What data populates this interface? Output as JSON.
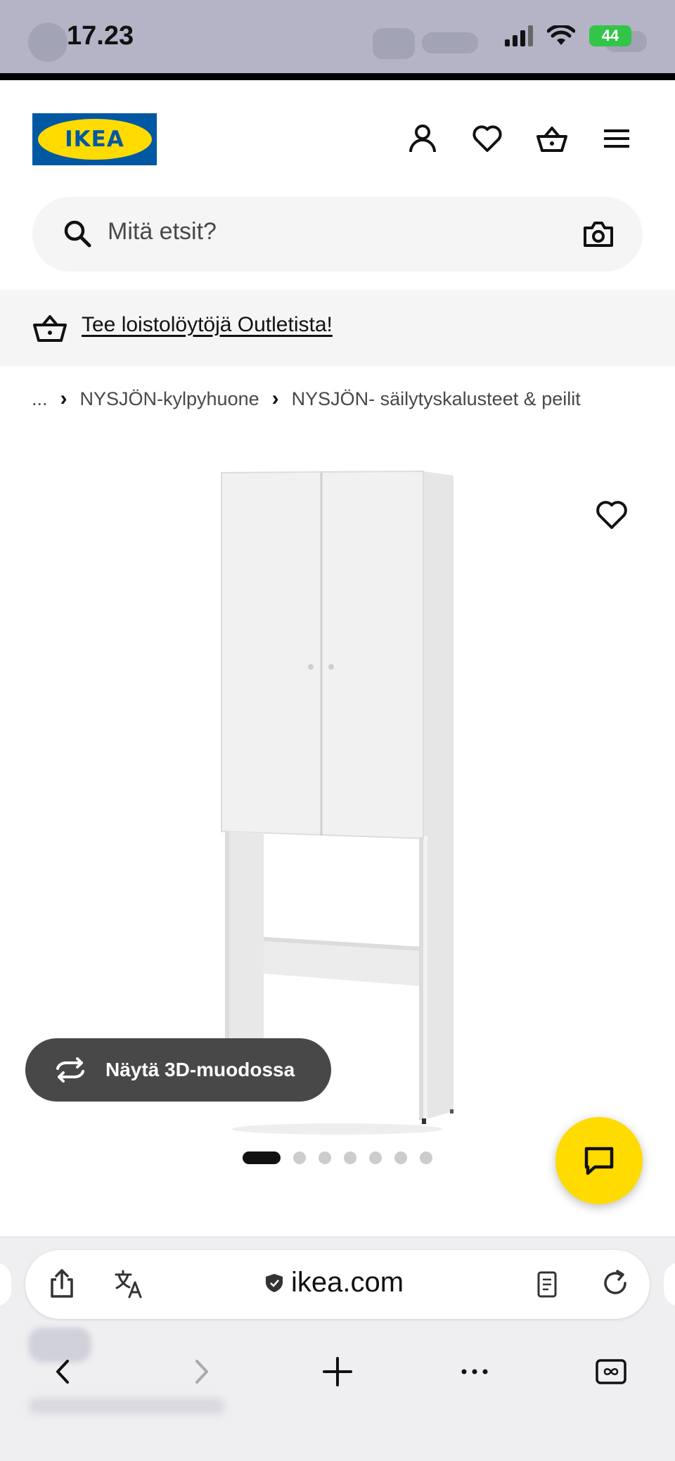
{
  "status_bar": {
    "time": "17.23",
    "battery": "44"
  },
  "header": {
    "logo_text": "IKEA",
    "colors": {
      "logo_blue": "#0058a3",
      "logo_yellow": "#ffdb00"
    },
    "icons": [
      "account-icon",
      "heart-icon",
      "basket-icon",
      "menu-icon"
    ]
  },
  "search": {
    "placeholder": "Mitä etsit?"
  },
  "banner": {
    "text": "Tee loistolöytöjä Outletista!"
  },
  "breadcrumb": {
    "items": [
      "...",
      "NYSJÖN-kylpyhuone",
      "NYSJÖN- säilytyskalusteet & peilit"
    ]
  },
  "product": {
    "view_3d_label": "Näytä 3D-muodossa",
    "image_count": 7,
    "active_image": 1
  },
  "chat": {
    "color": "#ffdb00"
  },
  "browser": {
    "url": "ikea.com",
    "toolbar_icons": [
      "share-icon",
      "translate-icon",
      "reader-icon",
      "reload-icon"
    ],
    "nav_icons": [
      "back-icon",
      "forward-icon",
      "new-tab-icon",
      "more-icon",
      "tabs-icon"
    ]
  }
}
